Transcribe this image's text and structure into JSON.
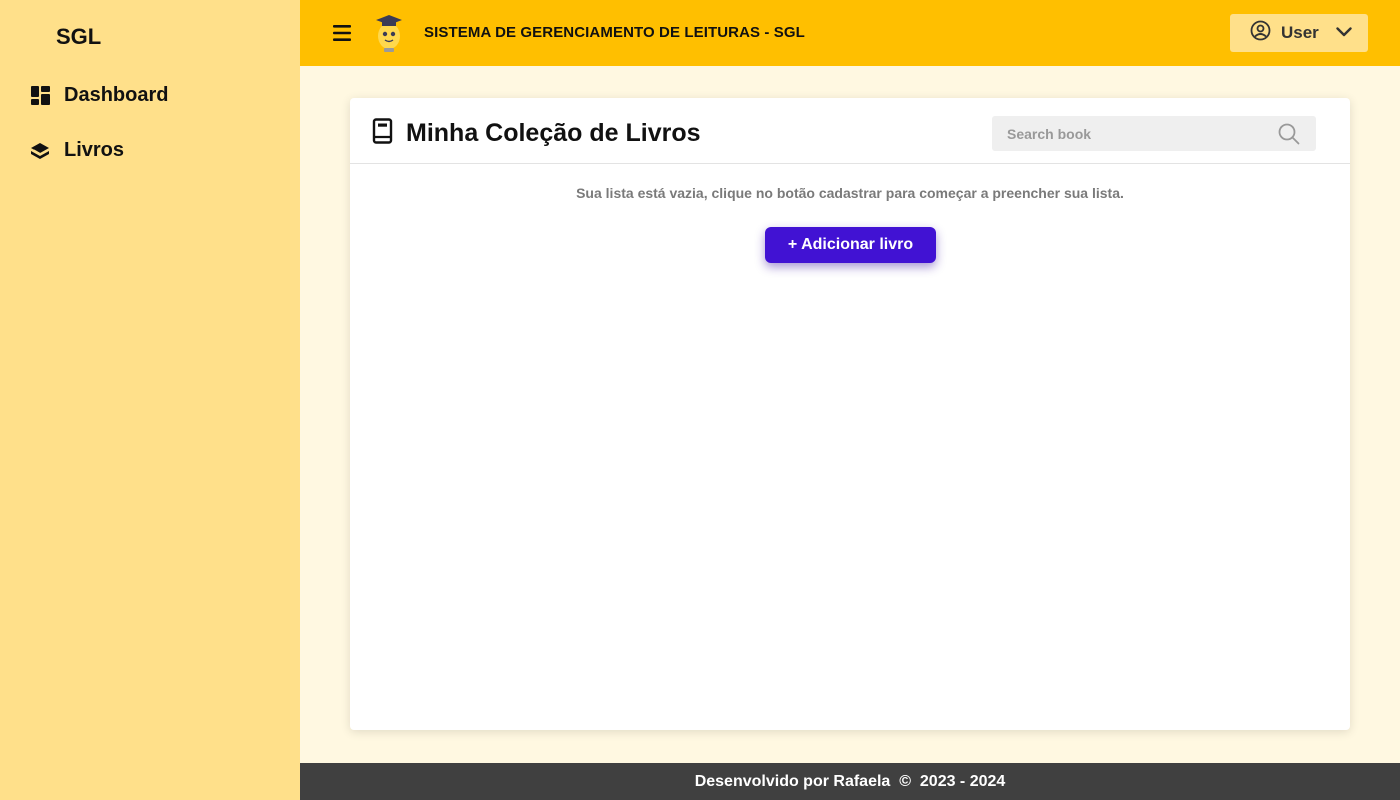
{
  "sidebar": {
    "brand": "SGL",
    "items": [
      {
        "label": "Dashboard",
        "icon": "dashboard-icon"
      },
      {
        "label": "Livros",
        "icon": "book-stack-icon"
      }
    ]
  },
  "header": {
    "title": "SISTEMA DE GERENCIAMENTO DE LEITURAS - SGL",
    "menu_icon": "hamburger-menu-icon",
    "user_label": "User",
    "colors": {
      "bar": "#ffbf00",
      "user_button": "#ffe08a"
    }
  },
  "main": {
    "title": "Minha Coleção de Livros",
    "search": {
      "placeholder": "Search book",
      "value": ""
    },
    "empty_message": "Sua lista está vazia, clique no botão cadastrar para começar a preencher sua lista.",
    "add_button_label": "+ Adicionar livro",
    "colors": {
      "accent": "#4112d3"
    }
  },
  "footer": {
    "text": "Desenvolvido por Rafaela  ©  2023 - 2024"
  }
}
